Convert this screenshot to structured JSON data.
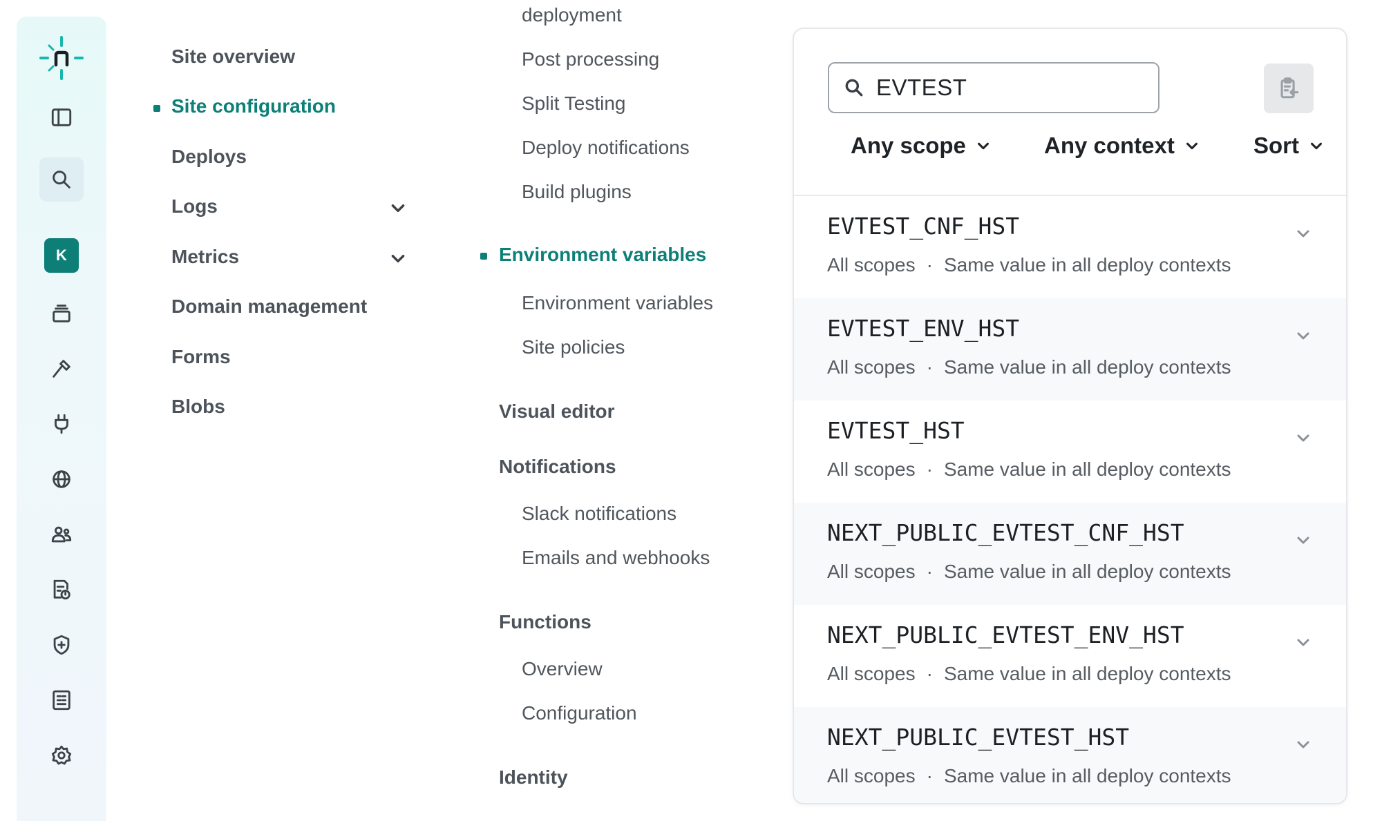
{
  "rail": {
    "avatar_initial": "K",
    "icons": [
      "netlify-logo-icon",
      "sidebar-toggle-icon",
      "search-icon",
      "avatar",
      "layers-icon",
      "hammer-icon",
      "plug-icon",
      "globe-icon",
      "team-icon",
      "usage-icon",
      "shield-icon",
      "billing-icon",
      "gear-icon"
    ]
  },
  "nav": {
    "items": [
      {
        "label": "Site overview"
      },
      {
        "label": "Site configuration"
      },
      {
        "label": "Deploys"
      },
      {
        "label": "Logs"
      },
      {
        "label": "Metrics"
      },
      {
        "label": "Domain management"
      },
      {
        "label": "Forms"
      },
      {
        "label": "Blobs"
      }
    ],
    "active_color": "#0c7f78"
  },
  "subnav": {
    "build_items": [
      "deployment",
      "Post processing",
      "Split Testing",
      "Deploy notifications",
      "Build plugins"
    ],
    "env_section": "Environment variables",
    "env_items": [
      "Environment variables",
      "Site policies"
    ],
    "visual_editor": "Visual editor",
    "notifications": "Notifications",
    "notification_items": [
      "Slack notifications",
      "Emails and webhooks"
    ],
    "functions": "Functions",
    "function_items": [
      "Overview",
      "Configuration"
    ],
    "identity": "Identity"
  },
  "panel": {
    "search_value": "EVTEST",
    "filters": {
      "scope": "Any scope",
      "context": "Any context",
      "sort": "Sort"
    },
    "variables": [
      {
        "name": "EVTEST_CNF_HST",
        "scope": "All scopes",
        "separator": "·",
        "contexts": "Same value in all deploy contexts"
      },
      {
        "name": "EVTEST_ENV_HST",
        "scope": "All scopes",
        "separator": "·",
        "contexts": "Same value in all deploy contexts"
      },
      {
        "name": "EVTEST_HST",
        "scope": "All scopes",
        "separator": "·",
        "contexts": "Same value in all deploy contexts"
      },
      {
        "name": "NEXT_PUBLIC_EVTEST_CNF_HST",
        "scope": "All scopes",
        "separator": "·",
        "contexts": "Same value in all deploy contexts"
      },
      {
        "name": "NEXT_PUBLIC_EVTEST_ENV_HST",
        "scope": "All scopes",
        "separator": "·",
        "contexts": "Same value in all deploy contexts"
      },
      {
        "name": "NEXT_PUBLIC_EVTEST_HST",
        "scope": "All scopes",
        "separator": "·",
        "contexts": "Same value in all deploy contexts"
      }
    ]
  }
}
